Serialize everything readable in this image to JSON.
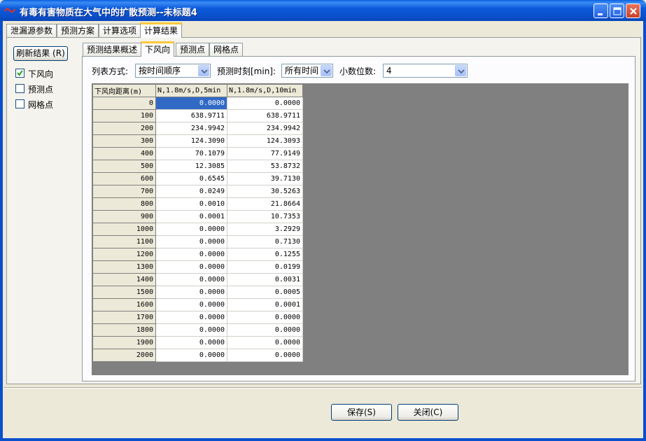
{
  "window": {
    "title": "有毒有害物质在大气中的扩散预测--未标题4",
    "minimize_icon": "minimize-icon",
    "maximize_icon": "maximize-icon",
    "close_icon": "close-icon"
  },
  "main_tabs": [
    {
      "label": "泄漏源参数"
    },
    {
      "label": "预测方案"
    },
    {
      "label": "计算选项"
    },
    {
      "label": "计算结果",
      "active": true
    }
  ],
  "refresh_button": "刷新结果 (R)",
  "left_checks": [
    {
      "label": "下风向",
      "checked": true
    },
    {
      "label": "预测点",
      "checked": false
    },
    {
      "label": "网格点",
      "checked": false
    }
  ],
  "sub_tabs": [
    {
      "label": "预测结果概述"
    },
    {
      "label": "下风向",
      "active": true
    },
    {
      "label": "预测点"
    },
    {
      "label": "网格点"
    }
  ],
  "filters": {
    "list_mode_label": "列表方式:",
    "list_mode_value": "按时间顺序",
    "time_label": "预测时刻[min]:",
    "time_value": "所有时间",
    "decimals_label": "小数位数:",
    "decimals_value": "4"
  },
  "table": {
    "headers": [
      "下风向距离(m)",
      "N,1.8m/s,D,5min",
      "N,1.8m/s,D,10min"
    ],
    "rows": [
      [
        "0",
        "0.0000",
        "0.0000"
      ],
      [
        "100",
        "638.9711",
        "638.9711"
      ],
      [
        "200",
        "234.9942",
        "234.9942"
      ],
      [
        "300",
        "124.3090",
        "124.3093"
      ],
      [
        "400",
        "70.1079",
        "77.9149"
      ],
      [
        "500",
        "12.3085",
        "53.8732"
      ],
      [
        "600",
        "0.6545",
        "39.7130"
      ],
      [
        "700",
        "0.0249",
        "30.5263"
      ],
      [
        "800",
        "0.0010",
        "21.8664"
      ],
      [
        "900",
        "0.0001",
        "10.7353"
      ],
      [
        "1000",
        "0.0000",
        "3.2929"
      ],
      [
        "1100",
        "0.0000",
        "0.7130"
      ],
      [
        "1200",
        "0.0000",
        "0.1255"
      ],
      [
        "1300",
        "0.0000",
        "0.0199"
      ],
      [
        "1400",
        "0.0000",
        "0.0031"
      ],
      [
        "1500",
        "0.0000",
        "0.0005"
      ],
      [
        "1600",
        "0.0000",
        "0.0001"
      ],
      [
        "1700",
        "0.0000",
        "0.0000"
      ],
      [
        "1800",
        "0.0000",
        "0.0000"
      ],
      [
        "1900",
        "0.0000",
        "0.0000"
      ],
      [
        "2000",
        "0.0000",
        "0.0000"
      ]
    ]
  },
  "footer": {
    "save_label": "保存(S)",
    "close_label": "关闭(C)"
  },
  "colors": {
    "titlebar": "#0A4FCB",
    "selection": "#316AC5",
    "active_tab_accent": "#FFC83C",
    "grid_background": "#808080"
  }
}
